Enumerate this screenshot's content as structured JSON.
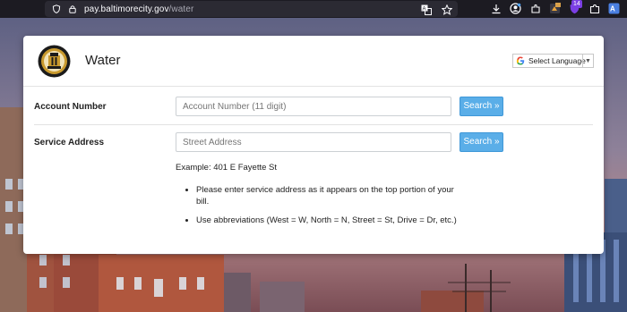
{
  "browser": {
    "url_host": "pay.baltimorecity.gov",
    "url_path": "/water",
    "extension_badge": "14"
  },
  "header": {
    "title": "Water",
    "language_label": "Select Language"
  },
  "account": {
    "label": "Account Number",
    "placeholder": "Account Number (11 digit)",
    "value": "",
    "button": "Search »"
  },
  "address": {
    "label": "Service Address",
    "placeholder": "Street Address",
    "value": "",
    "button": "Search »"
  },
  "help": {
    "example": "Example: 401 E Fayette St",
    "bullets": [
      "Please enter service address as it appears on the top portion of your bill.",
      "Use abbreviations (West = W, North = N, Street = St, Drive = Dr, etc.)"
    ]
  },
  "colors": {
    "button": "#5aaee8",
    "toolbar": "#1c1b22",
    "card": "#ffffff"
  }
}
